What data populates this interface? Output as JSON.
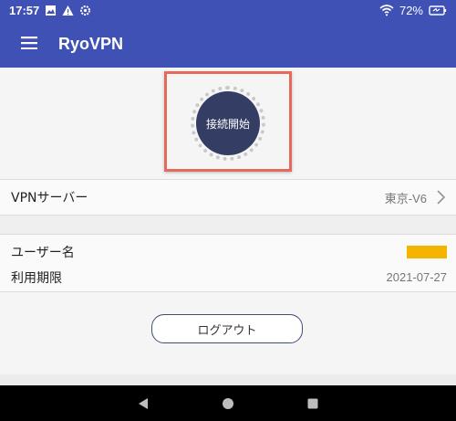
{
  "status_bar": {
    "time": "17:57",
    "battery_percent": "72%",
    "icons": [
      "image-icon",
      "warning-icon",
      "gear-icon",
      "wifi-icon",
      "battery-icon"
    ]
  },
  "app_bar": {
    "title": "RyoVPN",
    "menu_icon": "hamburger-menu-icon"
  },
  "connect": {
    "button_label": "接続開始"
  },
  "vpn_server": {
    "label": "VPNサーバー",
    "value": "東京-V6"
  },
  "user_info": {
    "username_label": "ユーザー名",
    "expiry_label": "利用期限",
    "expiry_value": "2021-07-27"
  },
  "logout": {
    "label": "ログアウト"
  },
  "nav": {
    "icons": [
      "back-icon",
      "home-icon",
      "recents-icon"
    ]
  },
  "colors": {
    "primary": "#3f51b5",
    "connect_button": "#343d63",
    "highlight": "#e46a5c",
    "redaction": "#f5b400"
  }
}
